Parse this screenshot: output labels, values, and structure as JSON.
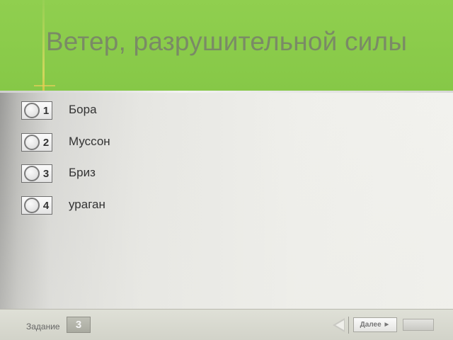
{
  "question": {
    "title": "Ветер, разрушительной силы"
  },
  "options": [
    {
      "number": "1",
      "label": "Бора"
    },
    {
      "number": "2",
      "label": "Муссон"
    },
    {
      "number": "3",
      "label": "Бриз"
    },
    {
      "number": "4",
      "label": "ураган"
    }
  ],
  "footer": {
    "task_label": "Задание",
    "task_number": "3",
    "next_label": "Далее ►"
  },
  "colors": {
    "header_green": "#8ccc4b",
    "title_text": "#7a8a66"
  },
  "icons": {
    "back": "back-arrow-icon",
    "radio": "radio-circle-icon"
  }
}
